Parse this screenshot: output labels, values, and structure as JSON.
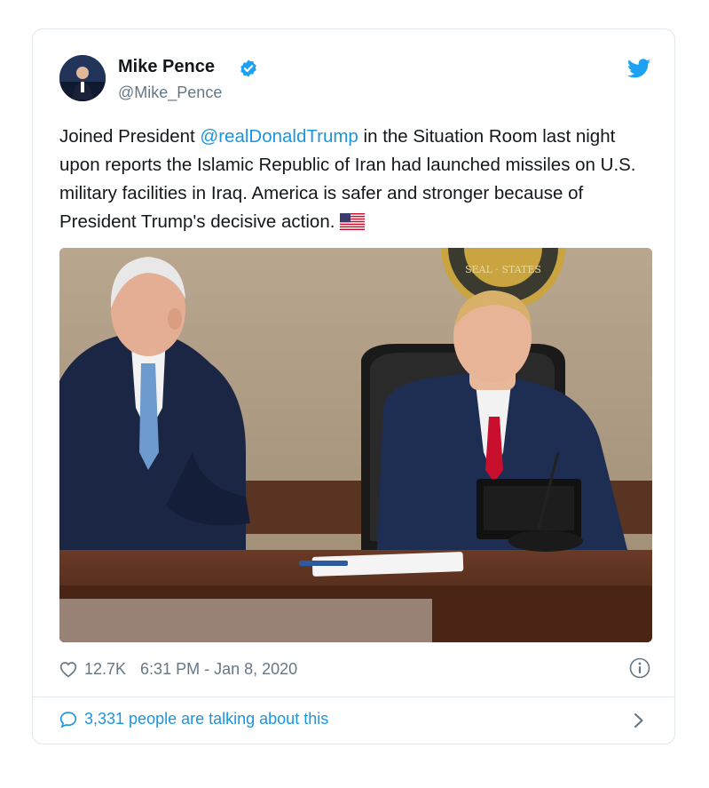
{
  "tweet": {
    "author_name": "Mike Pence",
    "author_handle": "@Mike_Pence",
    "text_before": "Joined President ",
    "mention": "@realDonaldTrump",
    "text_after": " in the Situation Room last night upon reports the Islamic Republic of Iran had launched missiles on U.S. military facilities in Iraq. America is safer and stronger because of President Trump's decisive action.",
    "likes": "12.7K",
    "timestamp": "6:31 PM - Jan 8, 2020",
    "talking": "3,331 people are talking about this",
    "seal_text": "SEAL · STATES"
  },
  "icons": {
    "verified": "verified-badge-icon",
    "brand": "twitter-bird-icon",
    "like": "heart-icon",
    "info": "info-icon",
    "comment": "speech-bubble-icon",
    "more": "chevron-right-icon",
    "emoji": "us-flag-icon"
  },
  "colors": {
    "accent": "#1b95e0",
    "text": "#14171a",
    "muted": "#657786",
    "border": "#e1e8ed"
  }
}
